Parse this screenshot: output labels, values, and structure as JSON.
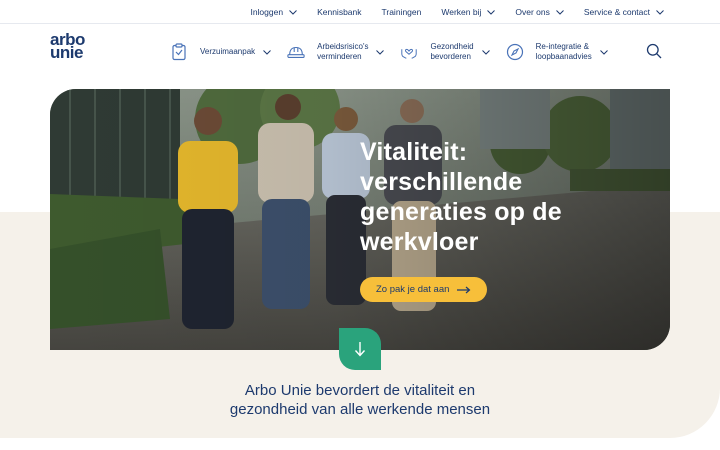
{
  "topnav": {
    "items": [
      {
        "label": "Inloggen",
        "dropdown": true
      },
      {
        "label": "Kennisbank",
        "dropdown": false
      },
      {
        "label": "Trainingen",
        "dropdown": false
      },
      {
        "label": "Werken bij",
        "dropdown": true
      },
      {
        "label": "Over ons",
        "dropdown": true
      },
      {
        "label": "Service & contact",
        "dropdown": true
      }
    ]
  },
  "logo": {
    "line1": "arbo",
    "line2": "unie"
  },
  "mainnav": {
    "items": [
      {
        "label_lines": [
          "Verzuimaanpak"
        ],
        "icon": "clipboard-icon"
      },
      {
        "label_lines": [
          "Arbeidsrisico's",
          "verminderen"
        ],
        "icon": "hard-hat-icon"
      },
      {
        "label_lines": [
          "Gezondheid",
          "bevorderen"
        ],
        "icon": "hands-heart-icon"
      },
      {
        "label_lines": [
          "Re-integratie &",
          "loopbaanadvies"
        ],
        "icon": "compass-icon"
      }
    ],
    "search_icon": "search-icon"
  },
  "hero": {
    "title_lines": [
      "Vitaliteit:",
      "verschillende",
      "generaties op de",
      "werkvloer"
    ],
    "cta_label": "Zo pak je dat aan",
    "image_desc_icon": "photo-four-colleagues-walking"
  },
  "scroll_button": {
    "icon": "arrow-down-icon"
  },
  "tagline": {
    "lines": [
      "Arbo Unie bevordert de vitaliteit en",
      "gezondheid van alle werkende mensen"
    ]
  },
  "colors": {
    "navy": "#1d3a6e",
    "teal": "#2aa37c",
    "yellow": "#f7bf3a",
    "beige": "#f5f1ea",
    "nav_icon_blue": "#4a73b8"
  }
}
